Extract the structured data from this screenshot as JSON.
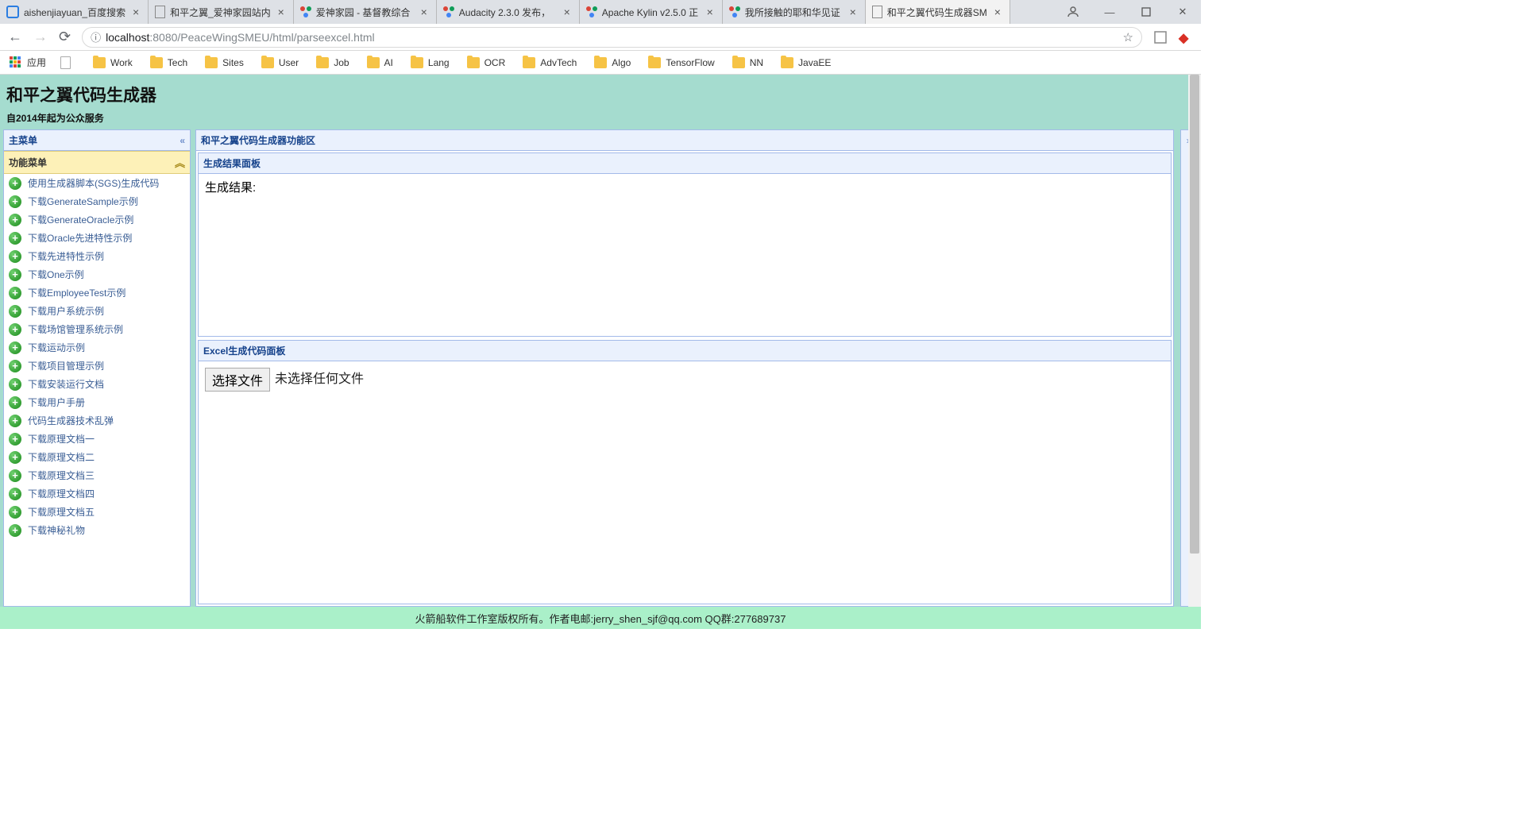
{
  "browser": {
    "tabs": [
      {
        "title": "aishenjiayuan_百度搜索",
        "active": false,
        "icon": "blue"
      },
      {
        "title": "和平之翼_爱神家园站内",
        "active": false,
        "icon": "doc"
      },
      {
        "title": "爱神家园 - 基督教综合",
        "active": false,
        "icon": "dots"
      },
      {
        "title": "Audacity 2.3.0 发布，",
        "active": false,
        "icon": "dots"
      },
      {
        "title": "Apache Kylin v2.5.0 正",
        "active": false,
        "icon": "dots"
      },
      {
        "title": "我所接触的耶和华见证",
        "active": false,
        "icon": "dots"
      },
      {
        "title": "和平之翼代码生成器SM",
        "active": true,
        "icon": "doc"
      }
    ],
    "url": {
      "prefix": "localhost",
      "port_path": ":8080/PeaceWingSMEU/html/parseexcel.html"
    },
    "apps_label": "应用",
    "bookmarks": [
      {
        "type": "page",
        "label": ""
      },
      {
        "type": "folder",
        "label": "Work"
      },
      {
        "type": "folder",
        "label": "Tech"
      },
      {
        "type": "folder",
        "label": "Sites"
      },
      {
        "type": "folder",
        "label": "User"
      },
      {
        "type": "folder",
        "label": "Job"
      },
      {
        "type": "folder",
        "label": "AI"
      },
      {
        "type": "folder",
        "label": "Lang"
      },
      {
        "type": "folder",
        "label": "OCR"
      },
      {
        "type": "folder",
        "label": "AdvTech"
      },
      {
        "type": "folder",
        "label": "Algo"
      },
      {
        "type": "folder",
        "label": "TensorFlow"
      },
      {
        "type": "folder",
        "label": "NN"
      },
      {
        "type": "folder",
        "label": "JavaEE"
      }
    ]
  },
  "page": {
    "title": "和平之翼代码生成器",
    "subtitle": "自2014年起为公众服务",
    "sidebar": {
      "main_menu_title": "主菜单",
      "func_menu_title": "功能菜单",
      "items": [
        "使用生成器脚本(SGS)生成代码",
        "下载GenerateSample示例",
        "下载GenerateOracle示例",
        "下载Oracle先进特性示例",
        "下载先进特性示例",
        "下载One示例",
        "下载EmployeeTest示例",
        "下载用户系统示例",
        "下载场馆管理系统示例",
        "下载运动示例",
        "下载项目管理示例",
        "下载安装运行文档",
        "下载用户手册",
        "代码生成器技术乱弹",
        "下载原理文档一",
        "下载原理文档二",
        "下载原理文档三",
        "下载原理文档四",
        "下载原理文档五",
        "下载神秘礼物"
      ]
    },
    "main": {
      "region_title": "和平之翼代码生成器功能区",
      "result_panel_title": "生成结果面板",
      "result_label": "生成结果:",
      "excel_panel_title": "Excel生成代码面板",
      "choose_file_btn": "选择文件",
      "no_file_text": "未选择任何文件"
    },
    "footer": "火箭船软件工作室版权所有。作者电邮:jerry_shen_sjf@qq.com QQ群:277689737"
  }
}
